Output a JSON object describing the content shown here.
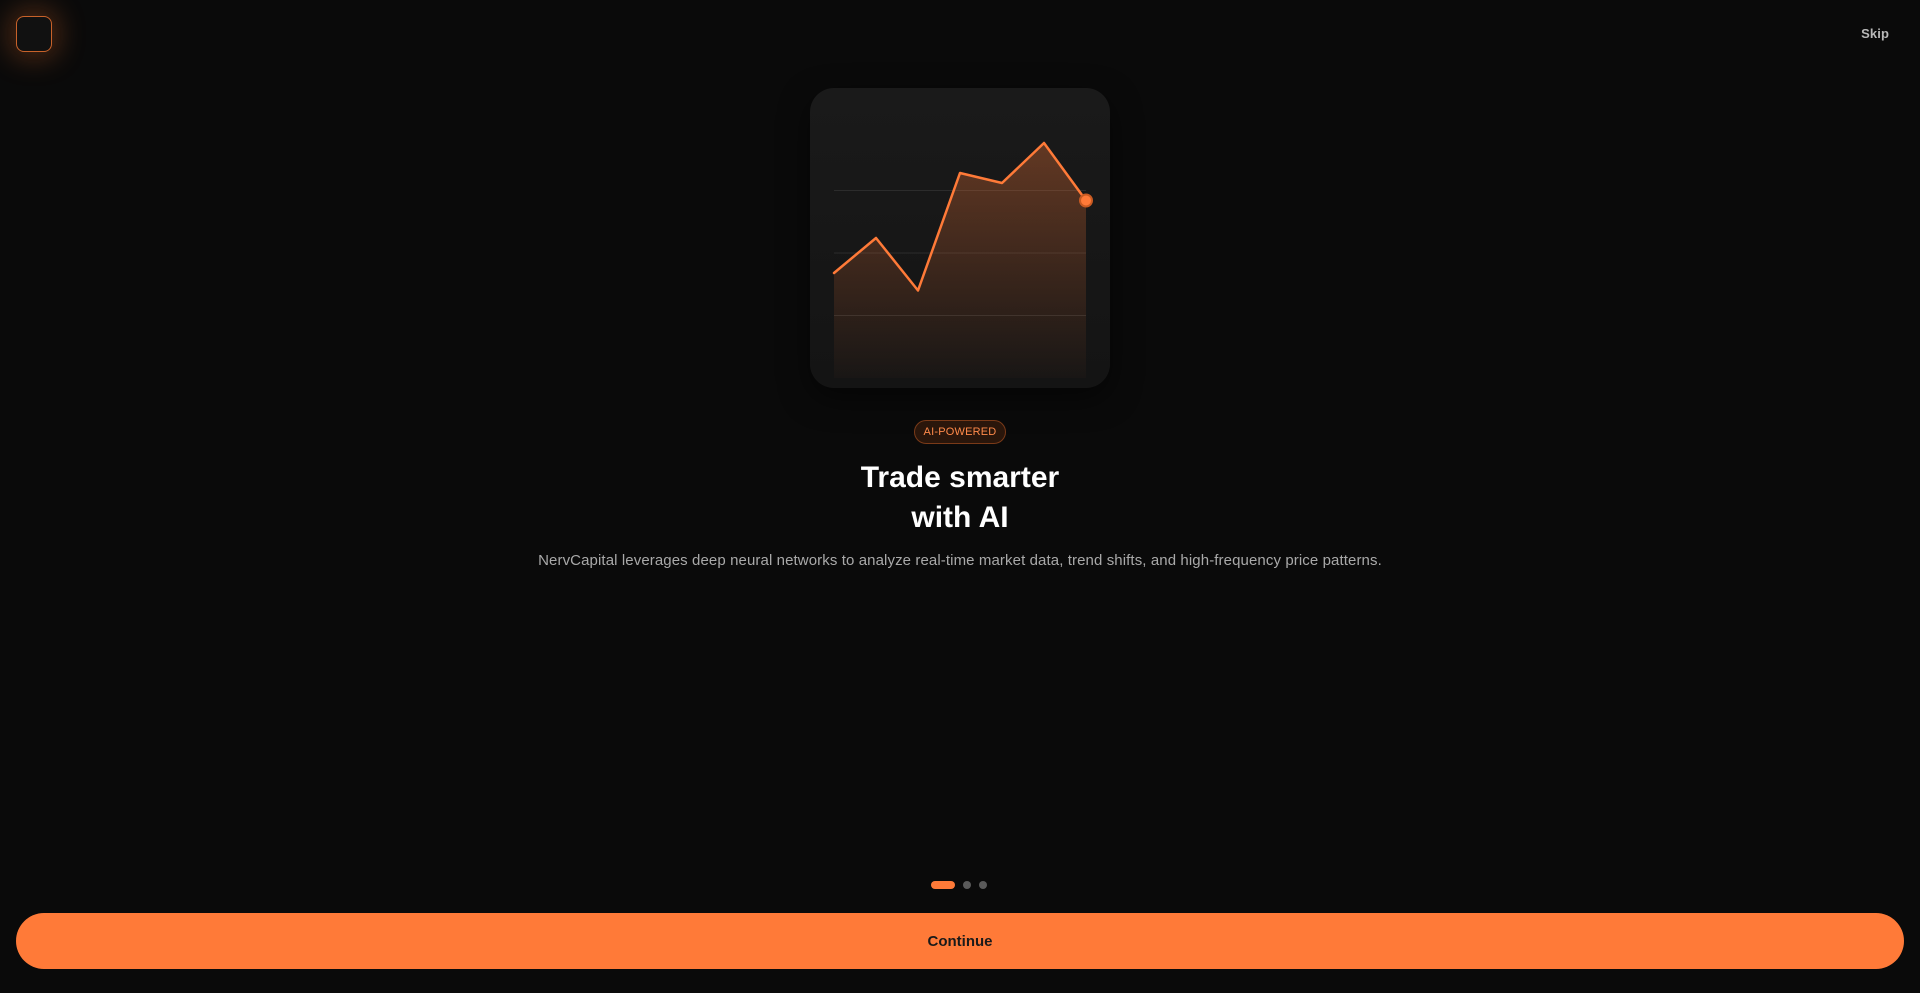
{
  "header": {
    "skip_label": "Skip"
  },
  "hero": {
    "badge": "AI-POWERED",
    "headline_line1": "Trade smarter",
    "headline_line2": "with AI",
    "description": "NervCapital leverages deep neural networks to analyze real-time market data, trend shifts, and high-frequency price patterns."
  },
  "pager": {
    "total": 3,
    "active_index": 0
  },
  "footer": {
    "continue_label": "Continue"
  },
  "colors": {
    "accent": "#ff7a38",
    "background": "#0a0a0a",
    "card": "#171717",
    "muted_text": "#a9a9a9"
  },
  "chart_data": {
    "type": "line",
    "x": [
      0,
      1,
      2,
      3,
      4,
      5,
      6
    ],
    "values": [
      42,
      56,
      35,
      82,
      78,
      94,
      71
    ],
    "ylim": [
      0,
      100
    ],
    "grid": true,
    "highlight_last_point": true
  }
}
